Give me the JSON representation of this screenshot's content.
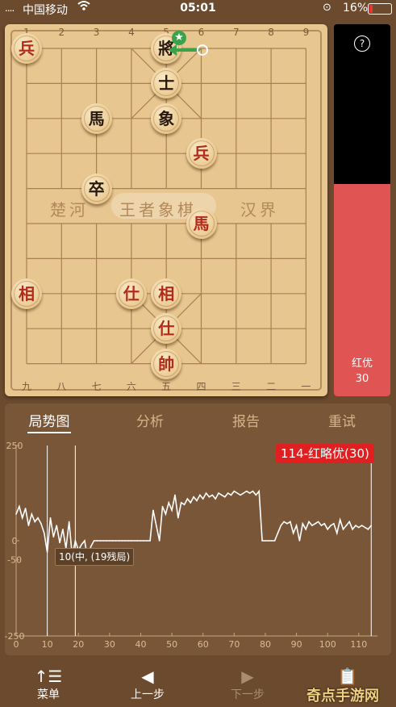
{
  "status_bar": {
    "signal": "....",
    "carrier": "中国移动",
    "wifi": "wifi-icon",
    "time": "05:01",
    "lock": "rotation-lock-icon",
    "battery": "16%",
    "battery_level": 0.16
  },
  "board": {
    "top_numbers": [
      "1",
      "2",
      "3",
      "4",
      "5",
      "6",
      "7",
      "8",
      "9"
    ],
    "bottom_numbers": [
      "九",
      "八",
      "七",
      "六",
      "五",
      "四",
      "三",
      "二",
      "一"
    ],
    "river_left": "楚河",
    "river_center": "王者象棋",
    "river_right": "汉界",
    "pieces": [
      {
        "char": "兵",
        "side": "red",
        "col": 0,
        "row": 0
      },
      {
        "char": "將",
        "side": "black",
        "col": 4,
        "row": 0
      },
      {
        "char": "士",
        "side": "black",
        "col": 4,
        "row": 1
      },
      {
        "char": "馬",
        "side": "black",
        "col": 2,
        "row": 2
      },
      {
        "char": "象",
        "side": "black",
        "col": 4,
        "row": 2
      },
      {
        "char": "兵",
        "side": "red",
        "col": 5,
        "row": 3
      },
      {
        "char": "卒",
        "side": "black",
        "col": 2,
        "row": 4
      },
      {
        "char": "馬",
        "side": "red",
        "col": 5,
        "row": 5
      },
      {
        "char": "相",
        "side": "red",
        "col": 0,
        "row": 7
      },
      {
        "char": "仕",
        "side": "red",
        "col": 3,
        "row": 7
      },
      {
        "char": "相",
        "side": "red",
        "col": 4,
        "row": 7
      },
      {
        "char": "仕",
        "side": "red",
        "col": 4,
        "row": 8
      },
      {
        "char": "帥",
        "side": "red",
        "col": 4,
        "row": 9
      }
    ],
    "last_move_marker": "star-icon"
  },
  "sidebar": {
    "help": "?",
    "eval_label": "红优",
    "eval_value": "30",
    "eval_fraction": 0.57
  },
  "tabs": {
    "t1": "局势图",
    "t2": "分析",
    "t3": "报告",
    "t4": "重试"
  },
  "chart_data": {
    "type": "line",
    "xlim": [
      0,
      116
    ],
    "ylim": [
      -250,
      250
    ],
    "x_ticks": [
      "0",
      "10",
      "20",
      "30",
      "40",
      "50",
      "60",
      "70",
      "80",
      "90",
      "100",
      "110"
    ],
    "y_ticks": [
      "250",
      "0",
      "-50",
      "-250"
    ],
    "highlight_label": "114-红略优(30)",
    "tooltip_label": "10(中, (19残局)",
    "x": [
      0,
      1,
      2,
      3,
      4,
      5,
      6,
      7,
      8,
      9,
      10,
      11,
      12,
      13,
      14,
      15,
      16,
      17,
      18,
      19,
      20,
      21,
      22,
      23,
      24,
      25,
      26,
      27,
      28,
      29,
      30,
      31,
      32,
      33,
      34,
      35,
      36,
      37,
      38,
      39,
      40,
      41,
      42,
      43,
      44,
      45,
      46,
      47,
      48,
      49,
      50,
      51,
      52,
      53,
      54,
      55,
      56,
      57,
      58,
      59,
      60,
      61,
      62,
      63,
      64,
      65,
      66,
      67,
      68,
      69,
      70,
      71,
      72,
      73,
      74,
      75,
      76,
      77,
      78,
      79,
      80,
      81,
      82,
      83,
      84,
      85,
      86,
      87,
      88,
      89,
      90,
      91,
      92,
      93,
      94,
      95,
      96,
      97,
      98,
      99,
      100,
      101,
      102,
      103,
      104,
      105,
      106,
      107,
      108,
      109,
      110,
      111,
      112,
      113,
      114
    ],
    "values": [
      70,
      90,
      60,
      85,
      40,
      70,
      50,
      60,
      45,
      20,
      -30,
      60,
      10,
      40,
      -5,
      30,
      -20,
      50,
      -40,
      0,
      -25,
      -10,
      0,
      -50,
      -15,
      0,
      0,
      0,
      0,
      0,
      0,
      0,
      0,
      0,
      0,
      0,
      0,
      0,
      0,
      0,
      0,
      0,
      0,
      0,
      80,
      40,
      0,
      90,
      70,
      100,
      80,
      120,
      60,
      100,
      95,
      110,
      100,
      115,
      105,
      120,
      110,
      125,
      115,
      120,
      110,
      125,
      120,
      115,
      125,
      120,
      130,
      125,
      120,
      125,
      130,
      125,
      130,
      120,
      130,
      0,
      0,
      0,
      0,
      0,
      20,
      40,
      50,
      45,
      50,
      20,
      40,
      0,
      45,
      30,
      50,
      40,
      45,
      50,
      40,
      45,
      30,
      40,
      45,
      20,
      55,
      30,
      40,
      50,
      30,
      40,
      35,
      40,
      35,
      30,
      40,
      30,
      35,
      30,
      55,
      30
    ],
    "highlight_x": 114,
    "tooltip_x": 10
  },
  "nav": {
    "menu": "菜单",
    "prev": "上一步",
    "next": "下一步",
    "last": "",
    "menu_icon": "menu-list-icon",
    "prev_icon": "triangle-left-icon",
    "next_icon": "triangle-right-icon",
    "last_icon": "clipboard-check-icon"
  },
  "watermark": "奇点手游网",
  "colors": {
    "accent_red": "#e05553",
    "badge_red": "#e02020",
    "board": "#e8c68f",
    "frame": "#6b4a2e"
  }
}
